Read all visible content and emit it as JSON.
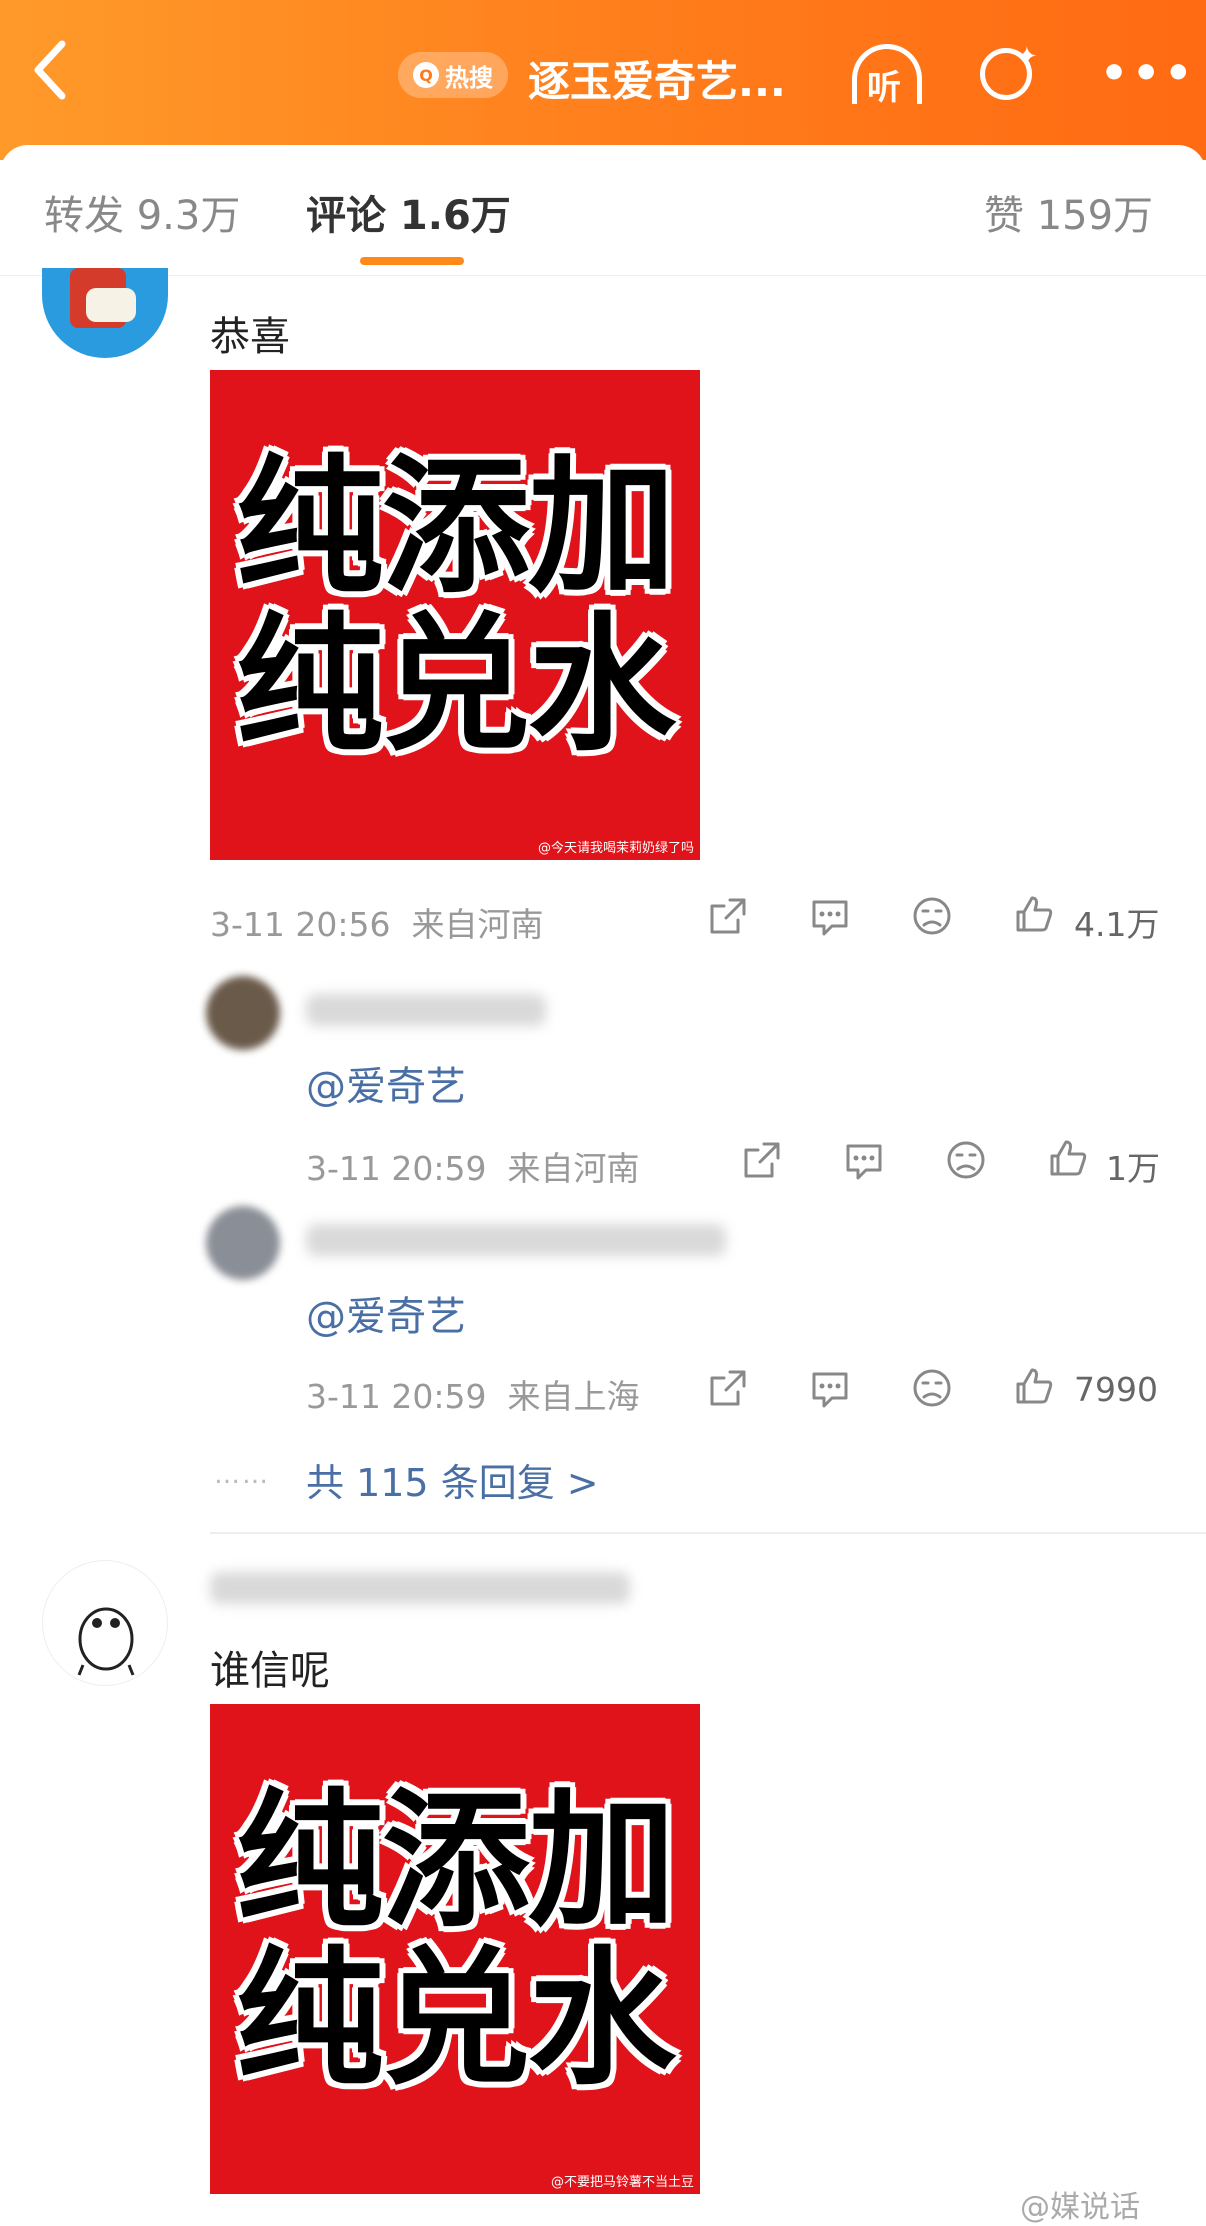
{
  "header": {
    "back_icon": "chevron-left-icon",
    "hot_label": "热搜",
    "topic_title": "逐玉爱奇艺...",
    "listen_label": "听",
    "accent_color": "#ff7a1a"
  },
  "tabs": [
    {
      "label": "转发 9.3万"
    },
    {
      "label": "评论 1.6万"
    },
    {
      "label": "赞 159万"
    }
  ],
  "comments": [
    {
      "text": "恭喜",
      "meme_lines": [
        "纯添加",
        "纯兑水"
      ],
      "meme_watermark": "@今天请我喝茉莉奶绿了吗",
      "time": "3-11 20:56",
      "location": "来自河南",
      "likes": "4.1万",
      "replies": [
        {
          "text": "@爱奇艺",
          "time": "3-11 20:59",
          "location": "来自河南",
          "likes": "1万"
        },
        {
          "text": "@爱奇艺",
          "time": "3-11 20:59",
          "location": "来自上海",
          "likes": "7990"
        }
      ],
      "dots": "……",
      "reply_summary": "共 115 条回复 >"
    },
    {
      "text": "谁信呢",
      "meme_lines": [
        "纯添加",
        "纯兑水"
      ],
      "meme_watermark": "@不要把马铃薯不当土豆"
    }
  ],
  "watermark": "@媒说话"
}
